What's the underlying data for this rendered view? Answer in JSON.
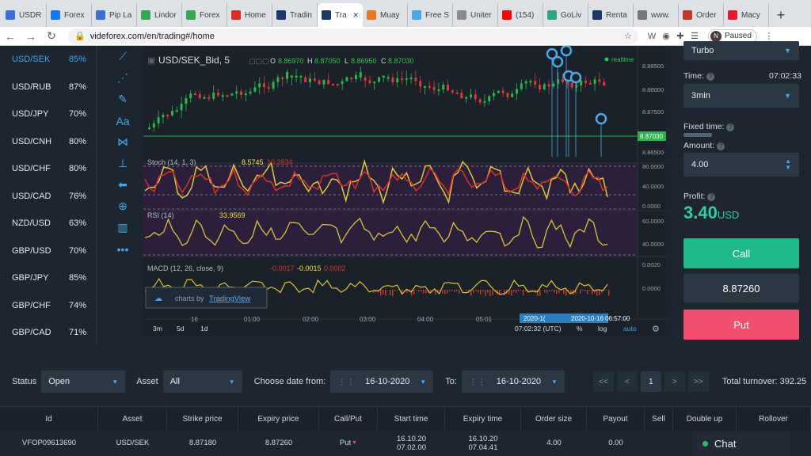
{
  "browser": {
    "tabs": [
      {
        "label": "USDR",
        "color": "#3b6fd8"
      },
      {
        "label": "Forex",
        "color": "#1877f2"
      },
      {
        "label": "Pip La",
        "color": "#3b6fd8"
      },
      {
        "label": "Lindor",
        "color": "#34a853"
      },
      {
        "label": "Forex",
        "color": "#34a853"
      },
      {
        "label": "Home",
        "color": "#d93025"
      },
      {
        "label": "Tradin",
        "color": "#1a3a6a"
      },
      {
        "label": "Tra",
        "color": "#1a3a6a"
      },
      {
        "label": "Muay",
        "color": "#e87722"
      },
      {
        "label": "Free S",
        "color": "#4aa8e8"
      },
      {
        "label": "Uniter",
        "color": "#8a8a8a"
      },
      {
        "label": "(154)",
        "color": "#ff0000"
      },
      {
        "label": "GoLiv",
        "color": "#2ea87a"
      },
      {
        "label": "Renta",
        "color": "#1a3a6a"
      },
      {
        "label": "www.",
        "color": "#777777"
      },
      {
        "label": "Order",
        "color": "#c0392b"
      },
      {
        "label": "Macy",
        "color": "#e21a2c"
      }
    ],
    "url": "videforex.com/en/trading#/home",
    "profile_initial": "N",
    "paused_label": "Paused"
  },
  "assets": [
    {
      "name": "USD/SEK",
      "pct": "85%",
      "active": true
    },
    {
      "name": "USD/RUB",
      "pct": "87%"
    },
    {
      "name": "USD/JPY",
      "pct": "70%"
    },
    {
      "name": "USD/CNH",
      "pct": "80%"
    },
    {
      "name": "USD/CHF",
      "pct": "80%"
    },
    {
      "name": "USD/CAD",
      "pct": "76%"
    },
    {
      "name": "NZD/USD",
      "pct": "63%"
    },
    {
      "name": "GBP/USD",
      "pct": "70%"
    },
    {
      "name": "GBP/JPY",
      "pct": "85%"
    },
    {
      "name": "GBP/CHF",
      "pct": "74%"
    },
    {
      "name": "GBP/CAD",
      "pct": "71%"
    }
  ],
  "chart": {
    "symbol": "USD/SEK_Bid, 5",
    "ohlc": {
      "o": "8.86970",
      "h": "8.87050",
      "l": "8.86950",
      "c": "8.87030"
    },
    "realtime": "realtime",
    "price_ticks": [
      "8.88500",
      "8.88000",
      "8.87500",
      "8.86500"
    ],
    "current_price": "8.87030",
    "stoch_label": "Stoch (14, 1, 3)",
    "stoch_value": "8.5745",
    "stoch_value2": "10.2834",
    "stoch_ticks": [
      "80.0000",
      "40.0000",
      "0.0000"
    ],
    "rsi_label": "RSI (14)",
    "rsi_value": "33.9569",
    "rsi_ticks": [
      "60.0000",
      "40.0000"
    ],
    "macd_label": "MACD (12, 26, close, 9)",
    "macd_values": [
      "-0.0017",
      "-0.0015",
      "0.0002"
    ],
    "macd_ticks": [
      "0.0020",
      "0.0000"
    ],
    "time_ticks": [
      "16",
      "01:00",
      "02:00",
      "03:00",
      "04:00",
      "05:01"
    ],
    "time_highlight": "2020-10-16 06:57:00",
    "time_highlight_prefix": "2020-1(",
    "ranges": [
      "3m",
      "5d",
      "1d"
    ],
    "clock": "07:02:32 (UTC)",
    "percent_btn": "%",
    "log_btn": "log",
    "auto_btn": "auto",
    "watermark": "charts by",
    "watermark_brand": "TradingView"
  },
  "trade_panel": {
    "mode": "Turbo",
    "time_label": "Time:",
    "time_clock": "07:02:33",
    "expiry": "3min",
    "fixed_time_label": "Fixed time:",
    "amount_label": "Amount:",
    "amount": "4.00",
    "profit_label": "Profit:",
    "profit_value": "3.40",
    "profit_currency": "USD",
    "call_label": "Call",
    "price": "8.87260",
    "put_label": "Put"
  },
  "filters": {
    "status_label": "Status",
    "status_value": "Open",
    "asset_label": "Asset",
    "asset_value": "All",
    "date_from_label": "Choose date from:",
    "date_from": "16-10-2020",
    "to_label": "To:",
    "date_to": "16-10-2020",
    "page": "1",
    "turnover": "Total turnover: 392.25"
  },
  "table": {
    "headers": [
      "Id",
      "Asset",
      "Strike price",
      "Expiry price",
      "Call/Put",
      "Start time",
      "Expiry time",
      "Order size",
      "Payout",
      "Sell",
      "Double up",
      "Rollover"
    ],
    "row": {
      "id": "VFOP09613690",
      "asset": "USD/SEK",
      "strike": "8.87180",
      "expiry_price": "8.87260",
      "callput": "Put",
      "start_date": "16.10.20",
      "start_time": "07.02.00",
      "expiry_date": "16.10.20",
      "expiry_time": "07.04.41",
      "order_size": "4.00",
      "payout": "0.00"
    }
  },
  "chat_label": "Chat",
  "colors": {
    "accent": "#3fa8ea",
    "call": "#1fb98c",
    "put": "#f0506e",
    "profit": "#2ecfa0"
  }
}
